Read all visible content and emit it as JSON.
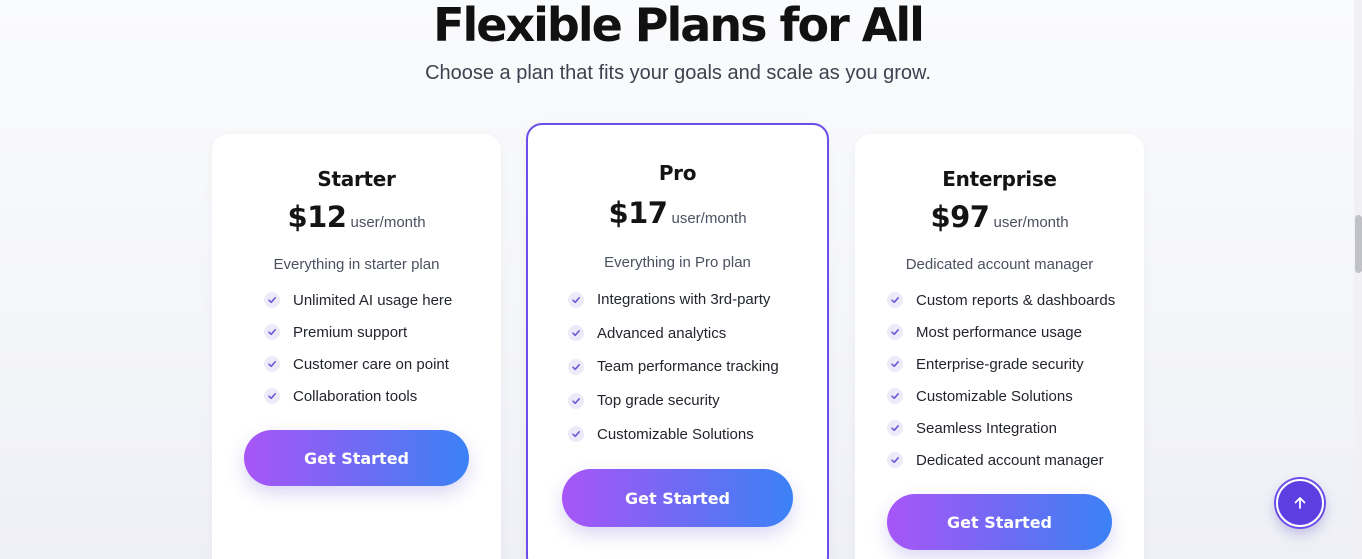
{
  "hero": {
    "title": "Flexible Plans for All",
    "subtitle": "Choose a plan that fits your goals and scale as you grow."
  },
  "plans": [
    {
      "name": "Starter",
      "price": "$12",
      "period": "user/month",
      "description": "Everything in starter plan",
      "features": [
        "Unlimited AI usage here",
        "Premium support",
        "Customer care on point",
        "Collaboration tools"
      ],
      "cta": "Get Started"
    },
    {
      "name": "Pro",
      "price": "$17",
      "period": "user/month",
      "description": "Everything in Pro plan",
      "features": [
        "Integrations with 3rd-party",
        "Advanced analytics",
        "Team performance tracking",
        "Top grade security",
        "Customizable Solutions"
      ],
      "cta": "Get Started",
      "highlighted": true
    },
    {
      "name": "Enterprise",
      "price": "$97",
      "period": "user/month",
      "description": "Dedicated account manager",
      "features": [
        "Custom reports & dashboards",
        "Most performance usage",
        "Enterprise-grade security",
        "Customizable Solutions",
        "Seamless Integration",
        "Dedicated account manager"
      ],
      "cta": "Get Started"
    }
  ],
  "icons": {
    "feature": "check-icon",
    "scroll_top": "arrow-up-icon"
  },
  "colors": {
    "accent": "#6d4ee8",
    "gradient_start": "#a855f7",
    "gradient_end": "#3b82f6",
    "check_bg": "#eceaf8",
    "check_mark": "#6b5bd6"
  }
}
